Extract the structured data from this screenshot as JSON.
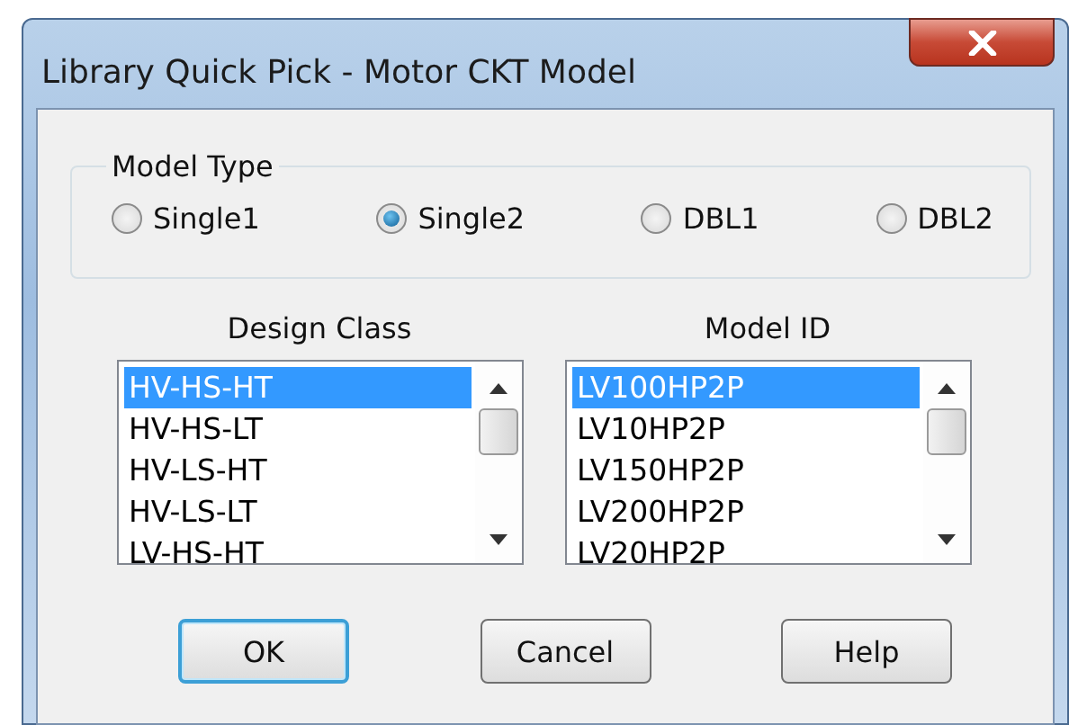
{
  "window": {
    "title": "Library Quick Pick - Motor CKT Model"
  },
  "model_type": {
    "label": "Model Type",
    "options": [
      {
        "label": "Single1",
        "selected": false
      },
      {
        "label": "Single2",
        "selected": true
      },
      {
        "label": "DBL1",
        "selected": false
      },
      {
        "label": "DBL2",
        "selected": false
      }
    ]
  },
  "lists": [
    {
      "label": "Design Class",
      "items": [
        {
          "text": "HV-HS-HT",
          "selected": true
        },
        {
          "text": "HV-HS-LT",
          "selected": false
        },
        {
          "text": "HV-LS-HT",
          "selected": false
        },
        {
          "text": "HV-LS-LT",
          "selected": false
        },
        {
          "text": "LV-HS-HT",
          "selected": false
        }
      ]
    },
    {
      "label": "Model ID",
      "items": [
        {
          "text": "LV100HP2P",
          "selected": true
        },
        {
          "text": "LV10HP2P",
          "selected": false
        },
        {
          "text": "LV150HP2P",
          "selected": false
        },
        {
          "text": "LV200HP2P",
          "selected": false
        },
        {
          "text": "LV20HP2P",
          "selected": false
        }
      ]
    }
  ],
  "buttons": [
    {
      "label": "OK",
      "default": true
    },
    {
      "label": "Cancel",
      "default": false
    },
    {
      "label": "Help",
      "default": false
    }
  ]
}
